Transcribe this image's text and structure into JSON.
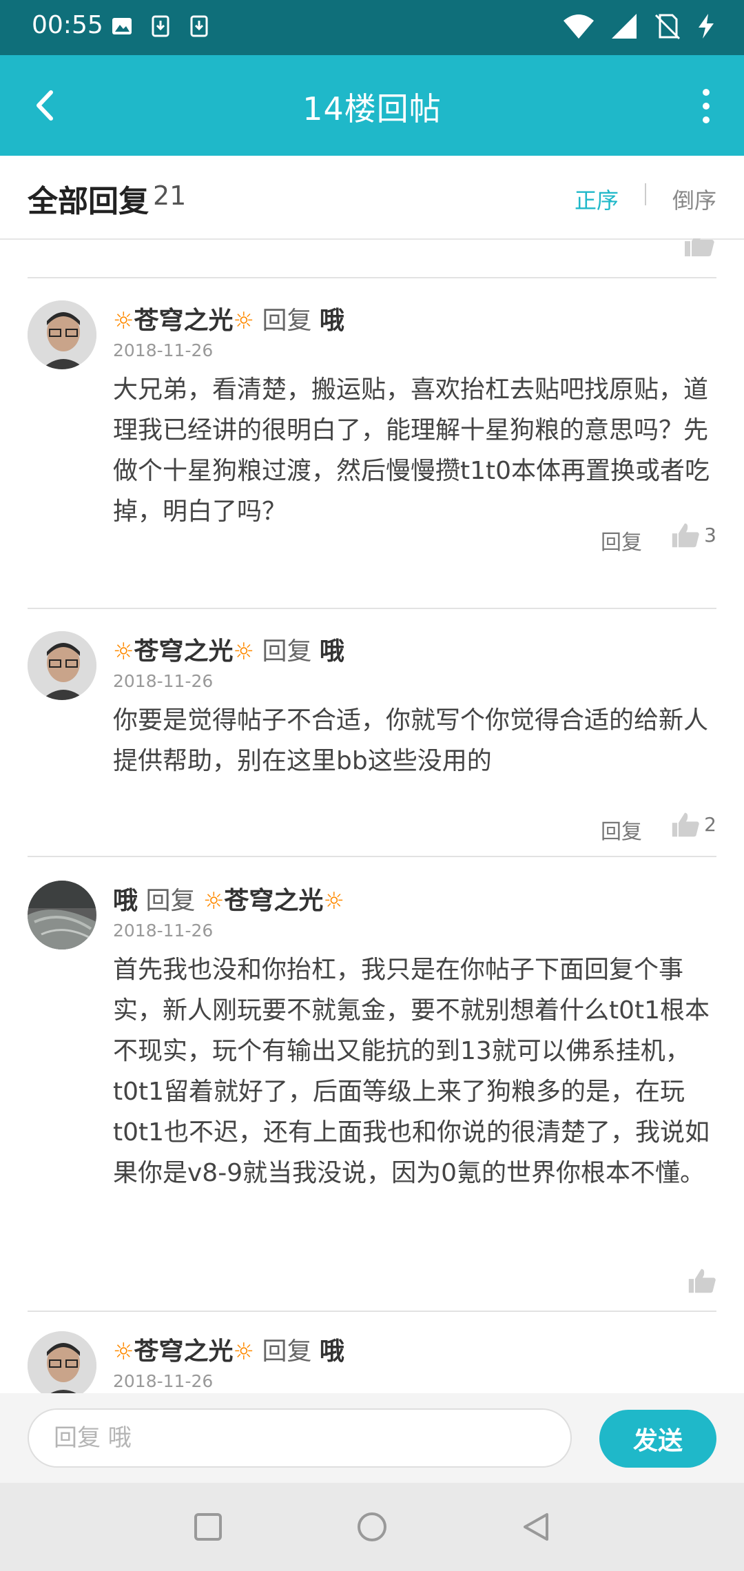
{
  "status_bar": {
    "time": "00:55"
  },
  "app_bar": {
    "title": "14楼回帖"
  },
  "header": {
    "title": "全部回复",
    "count": "21",
    "sort_asc": "正序",
    "sort_desc": "倒序"
  },
  "comments": [
    {
      "author": "苍穹之光",
      "reply_word": "回复",
      "reply_to": "哦",
      "date": "2018-11-26",
      "text": "大兄弟，看清楚，搬运贴，喜欢抬杠去贴吧找原贴，道理我已经讲的很明白了，能理解十星狗粮的意思吗？先做个十星狗粮过渡，然后慢慢攒t1t0本体再置换或者吃掉，明白了吗？",
      "reply_label": "回复",
      "likes": "3"
    },
    {
      "author": "苍穹之光",
      "reply_word": "回复",
      "reply_to": "哦",
      "date": "2018-11-26",
      "text": "你要是觉得帖子不合适，你就写个你觉得合适的给新人提供帮助，别在这里bb这些没用的",
      "reply_label": "回复",
      "likes": "2"
    },
    {
      "author": "哦",
      "reply_word": "回复",
      "reply_to": "苍穹之光",
      "date": "2018-11-26",
      "text": "首先我也没和你抬杠，我只是在你帖子下面回复个事实，新人刚玩要不就氪金，要不就别想着什么t0t1根本不现实，玩个有输出又能抗的到13就可以佛系挂机，t0t1留着就好了，后面等级上来了狗粮多的是，在玩t0t1也不迟，还有上面我也和你说的很清楚了，我说如果你是v8-9就当我没说，因为0氪的世界你根本不懂。"
    },
    {
      "author": "苍穹之光",
      "reply_word": "回复",
      "reply_to": "哦",
      "date": "2018-11-26"
    }
  ],
  "input_bar": {
    "placeholder": "回复 哦",
    "send_label": "发送"
  },
  "colors": {
    "accent": "#1fb8c9",
    "status_bar": "#0f6f7a",
    "sun": "#ff8a00"
  }
}
